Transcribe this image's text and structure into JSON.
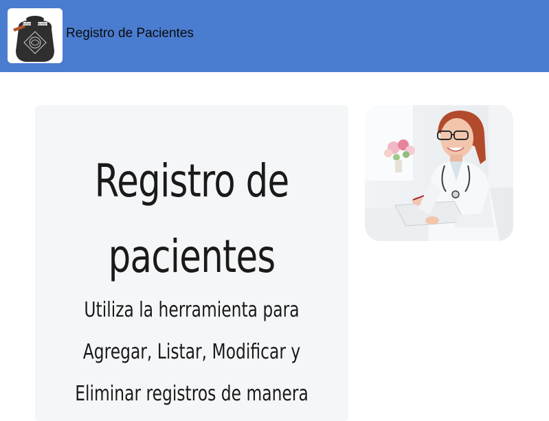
{
  "navbar": {
    "title": "Registro de Pacientes",
    "logo_text_left": "Bolsas",
    "logo_text_right": "Nombre"
  },
  "hero": {
    "title_line1": "Registro de",
    "title_line2": "pacientes",
    "text_line1": "Utiliza la herramienta para",
    "text_line2": "Agregar, Listar, Modificar y",
    "text_line3": "Eliminar registros de manera"
  },
  "colors": {
    "navbar_bg": "#4a7ccf",
    "card_bg": "#f5f6f8",
    "text": "#1a1a1a"
  },
  "icons": {
    "logo": "bag-logo-icon",
    "photo": "doctor-photo"
  }
}
